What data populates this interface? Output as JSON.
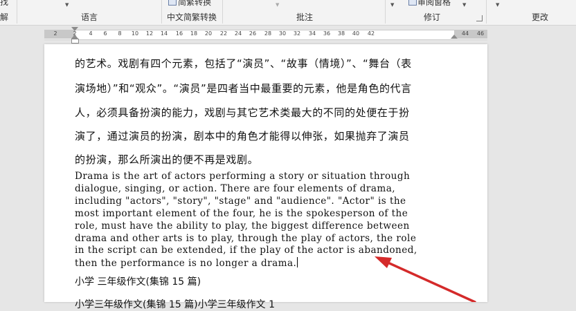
{
  "ribbon": {
    "find_partial": "找",
    "explain_partial": "解",
    "simp_trad_convert": "简繁转换",
    "group_language": "语言",
    "group_cn_convert": "中文简繁转换",
    "group_comments": "批注",
    "review_pane": "审阅窗格",
    "group_tracking": "修订",
    "group_changes": "更改"
  },
  "ruler": {
    "ticks": [
      "2",
      "2",
      "4",
      "6",
      "8",
      "10",
      "12",
      "14",
      "16",
      "18",
      "20",
      "22",
      "24",
      "26",
      "28",
      "30",
      "32",
      "34",
      "36",
      "38",
      "40",
      "42",
      "44",
      "46"
    ]
  },
  "document": {
    "cn_lines": [
      "的艺术。戏剧有四个元素，包括了“演员”、“故事（情境）”、“舞台（表",
      "演场地）”和“观众”。“演员”是四者当中最重要的元素，他是角色的代言",
      "人，必须具备扮演的能力，戏剧与其它艺术类最大的不同的处便在于扮",
      "演了，通过演员的扮演，剧本中的角色才能得以伸张，如果抛弃了演员",
      "的扮演，那么所演出的便不再是戏剧。"
    ],
    "en_lines": [
      "Drama is the art of actors performing a story or situation through",
      "dialogue, singing, or action. There are four elements of drama,",
      "including \"actors\", \"story\", \"stage\" and \"audience\". \"Actor\" is the",
      "most important element of the four, he is the spokesperson of the",
      "role, must have the ability to play, the biggest difference between",
      "drama and other arts is to play, through the play of actors, the role",
      "in the script can be extended, if the play of the actor is abandoned,",
      "then the performance is no longer a drama."
    ],
    "heading": "小学 三年级作文(集锦 15 篇)",
    "partial_line": "小学三年级作文(集锦 15 篇)小学三年级作文 1"
  },
  "colors": {
    "arrow": "#d42a2a",
    "ribbon_bg": "#f3f3f3",
    "workspace_bg": "#e6e6e6"
  }
}
